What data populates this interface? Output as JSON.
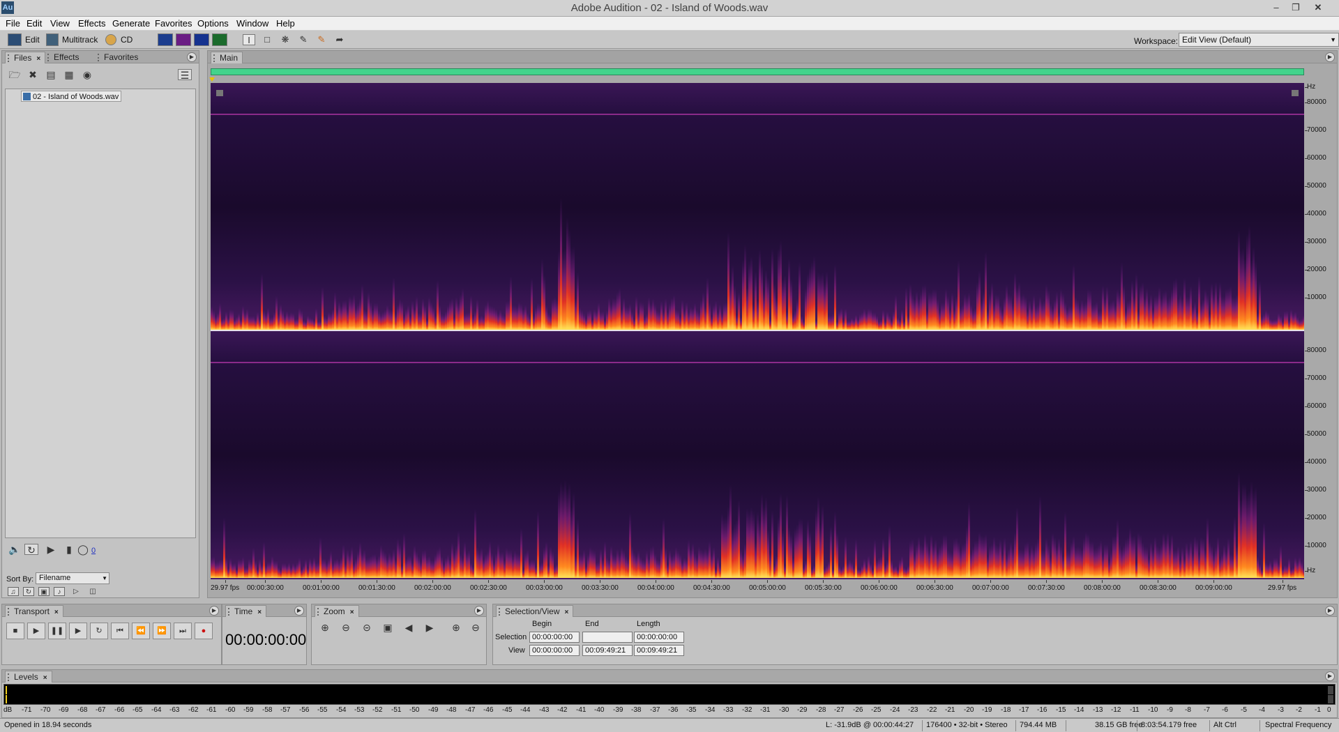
{
  "window": {
    "title": "Adobe Audition - 02 - Island of Woods.wav",
    "app_icon_text": "Au",
    "controls": [
      "minimize-icon",
      "restore-icon",
      "close-icon"
    ]
  },
  "menu": [
    "File",
    "Edit",
    "View",
    "Effects",
    "Generate",
    "Favorites",
    "Options",
    "Window",
    "Help"
  ],
  "toolbar": {
    "edit_label": "Edit",
    "multitrack_label": "Multitrack",
    "cd_label": "CD",
    "workspace_label": "Workspace:",
    "workspace_value": "Edit View (Default)"
  },
  "files_panel": {
    "tabs": [
      "Files",
      "Effects",
      "Favorites"
    ],
    "file_name": "02 - Island of Woods.wav",
    "volume_value": "0",
    "sort_label": "Sort By:",
    "sort_value": "Filename"
  },
  "main_panel": {
    "tab": "Main",
    "hz_unit": "Hz",
    "hz_labels": [
      "80000",
      "70000",
      "60000",
      "50000",
      "40000",
      "30000",
      "20000",
      "10000"
    ],
    "time_ticks": [
      "29.97 fps",
      "00:00:30:00",
      "00:01:00:00",
      "00:01:30:00",
      "00:02:00:00",
      "00:02:30:00",
      "00:03:00:00",
      "00:03:30:00",
      "00:04:00:00",
      "00:04:30:00",
      "00:05:00:00",
      "00:05:30:00",
      "00:06:00:00",
      "00:06:30:00",
      "00:07:00:00",
      "00:07:30:00",
      "00:08:00:00",
      "00:08:30:00",
      "00:09:00:00",
      "29.97 fps"
    ],
    "colors": {
      "overview": "#43d38c",
      "spectrogram_bg": "#1b0c2c",
      "hot": "#ffd84a",
      "mid": "#e8322a",
      "cool": "#7a1f88"
    }
  },
  "transport": {
    "tab": "Transport"
  },
  "time_panel": {
    "tab": "Time",
    "display": "00:00:00:00"
  },
  "zoom_panel": {
    "tab": "Zoom"
  },
  "selection_view": {
    "tab": "Selection/View",
    "col_begin": "Begin",
    "col_end": "End",
    "col_length": "Length",
    "row_selection": "Selection",
    "row_view": "View",
    "selection_begin": "00:00:00:00",
    "selection_end": "",
    "selection_length": "00:00:00:00",
    "view_begin": "00:00:00:00",
    "view_end": "00:09:49:21",
    "view_length": "00:09:49:21"
  },
  "levels": {
    "tab": "Levels",
    "scale": [
      "dB",
      "-71",
      "-70",
      "-69",
      "-68",
      "-67",
      "-66",
      "-65",
      "-64",
      "-63",
      "-62",
      "-61",
      "-60",
      "-59",
      "-58",
      "-57",
      "-56",
      "-55",
      "-54",
      "-53",
      "-52",
      "-51",
      "-50",
      "-49",
      "-48",
      "-47",
      "-46",
      "-45",
      "-44",
      "-43",
      "-42",
      "-41",
      "-40",
      "-39",
      "-38",
      "-37",
      "-36",
      "-35",
      "-34",
      "-33",
      "-32",
      "-31",
      "-30",
      "-29",
      "-28",
      "-27",
      "-26",
      "-25",
      "-24",
      "-23",
      "-22",
      "-21",
      "-20",
      "-19",
      "-18",
      "-17",
      "-16",
      "-15",
      "-14",
      "-13",
      "-12",
      "-11",
      "-10",
      "-9",
      "-8",
      "-7",
      "-6",
      "-5",
      "-4",
      "-3",
      "-2",
      "-1",
      "0"
    ]
  },
  "status": {
    "opened": "Opened in 18.94 seconds",
    "cursor_level": "L: -31.9dB @ 00:00:44:27",
    "format": "176400 • 32-bit • Stereo",
    "file_size": "794.44 MB",
    "free_space": "38.15 GB free",
    "free_time": "8:03:54.179 free",
    "keys": "Alt Ctrl",
    "view_mode": "Spectral Frequency"
  }
}
